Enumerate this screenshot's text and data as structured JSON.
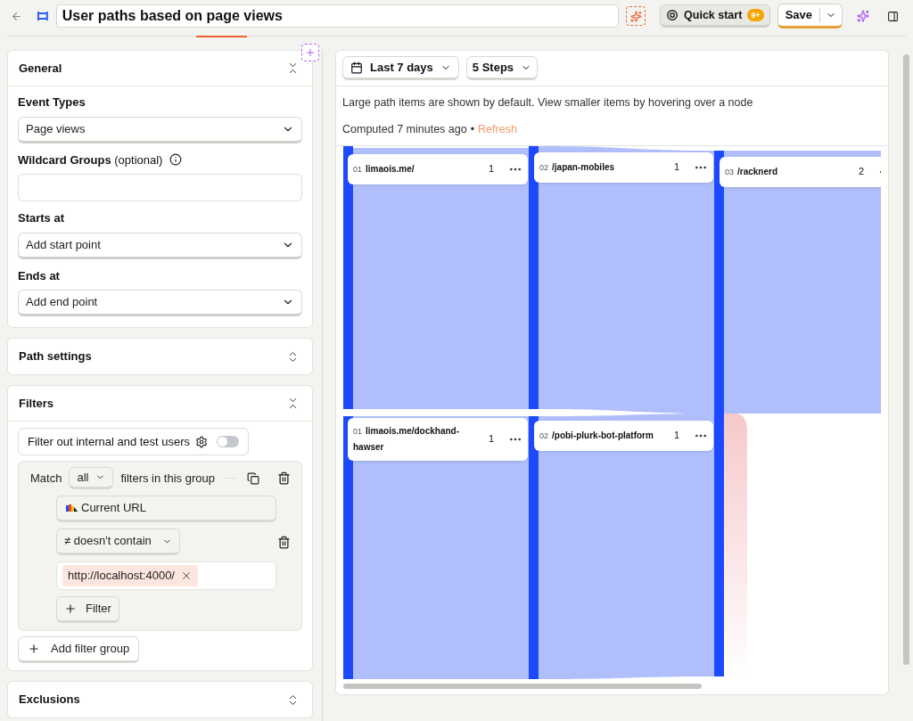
{
  "header": {
    "title": "User paths based on page views",
    "quick_start": {
      "label": "Quick start",
      "badge": "9+"
    },
    "save": "Save"
  },
  "general": {
    "title": "General",
    "expanded": true,
    "event_types": {
      "label": "Event Types",
      "value": "Page views"
    },
    "wildcard": {
      "label": "Wildcard Groups",
      "hint": "(optional)"
    },
    "starts_at": {
      "label": "Starts at",
      "placeholder": "Add start point"
    },
    "ends_at": {
      "label": "Ends at",
      "placeholder": "Add end point"
    }
  },
  "path_settings": {
    "title": "Path settings",
    "expanded": false
  },
  "filters": {
    "title": "Filters",
    "expanded": true,
    "internal_toggle": {
      "label": "Filter out internal and test users",
      "on": false
    },
    "group": {
      "match_label": "Match",
      "match_value": "all",
      "suffix": "filters in this group",
      "property": "Current URL",
      "operator": "≠ doesn't contain",
      "values": [
        "http://localhost:4000/"
      ],
      "add_filter": "Filter"
    },
    "add_group": "Add filter group"
  },
  "exclusions": {
    "title": "Exclusions",
    "expanded": false
  },
  "toolbar": {
    "date_range": "Last 7 days",
    "steps": "5 Steps"
  },
  "info": "Large path items are shown by default. View smaller items by hovering over a node",
  "computed": {
    "text": "Computed 7 minutes ago",
    "separator": "•",
    "refresh": "Refresh"
  },
  "path_nodes": [
    {
      "step": "01",
      "label": "limaois.me/",
      "count": "1"
    },
    {
      "step": "02",
      "label": "/japan-mobiles",
      "count": "1"
    },
    {
      "step": "03",
      "label": "/racknerd",
      "count": "2"
    },
    {
      "step": "01",
      "label": "limaois.me/dockhand-hawser",
      "count": "1"
    },
    {
      "step": "02",
      "label": "/pobi-plurk-bot-platform",
      "count": "1"
    }
  ]
}
